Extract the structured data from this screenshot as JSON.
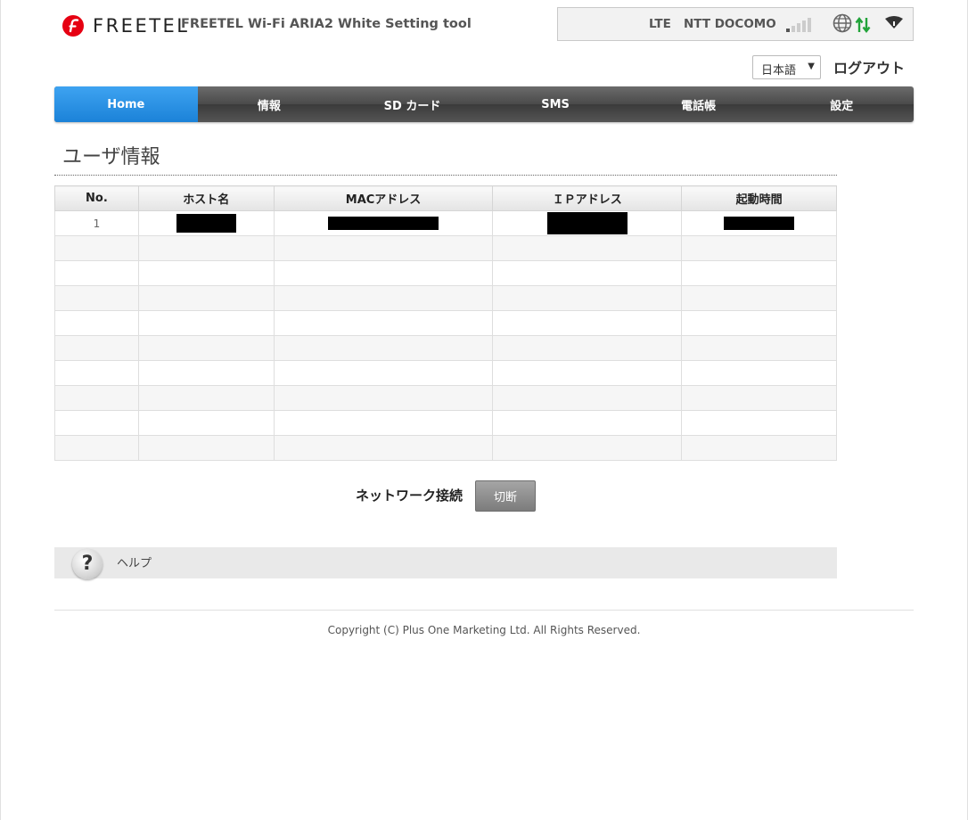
{
  "header": {
    "brand": "FREETEL",
    "app_title": "FREETEL Wi-Fi ARIA2 White Setting tool",
    "brand_color": "#e60012"
  },
  "status": {
    "network_type": "LTE",
    "carrier": "NTT DOCOMO",
    "signal_bars_active": 1,
    "signal_bars_total": 5,
    "icons": [
      "signal-strength-icon",
      "globe-icon",
      "data-transfer-icon",
      "wifi-icon"
    ]
  },
  "language": {
    "selected": "日本語"
  },
  "logout_label": "ログアウト",
  "nav": {
    "items": [
      "Home",
      "情報",
      "SD カード",
      "SMS",
      "電話帳",
      "設定"
    ],
    "active": "Home",
    "active_color": "#1b82d8"
  },
  "section": {
    "title": "ユーザ情報"
  },
  "table": {
    "headers": [
      "No.",
      "ホスト名",
      "MACアドレス",
      "ＩＰアドレス",
      "起動時間"
    ],
    "rows": [
      {
        "no": "1",
        "host": "[redacted]",
        "mac": "[redacted]",
        "ip": "[redacted]",
        "uptime": "[redacted]"
      }
    ],
    "empty_rows": 9
  },
  "network": {
    "label": "ネットワーク接続",
    "button": "切断"
  },
  "help": {
    "label": "ヘルプ",
    "icon": "?"
  },
  "footer": {
    "copyright": "Copyright (C) Plus One Marketing Ltd. All Rights Reserved."
  }
}
